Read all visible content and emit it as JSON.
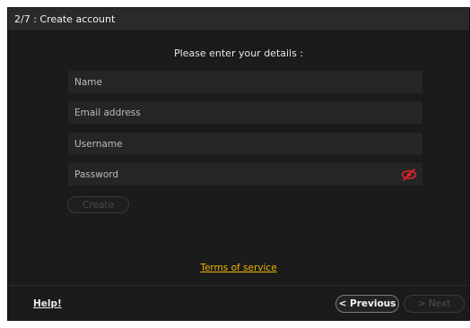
{
  "window": {
    "title": "2/7 : Create account"
  },
  "form": {
    "heading": "Please enter your details :",
    "name_placeholder": "Name",
    "email_placeholder": "Email address",
    "username_placeholder": "Username",
    "password_placeholder": "Password",
    "password_toggle_icon": "eye-slash-icon",
    "create_label": "Create"
  },
  "links": {
    "terms": "Terms of service",
    "help": "Help!"
  },
  "navigation": {
    "previous_label": "< Previous",
    "next_label": "> Next"
  },
  "colors": {
    "background": "#1b1b1c",
    "titlebar": "#2a2a2c",
    "field": "#252527",
    "link_accent": "#f0b400",
    "eye_accent": "#e0242a"
  }
}
